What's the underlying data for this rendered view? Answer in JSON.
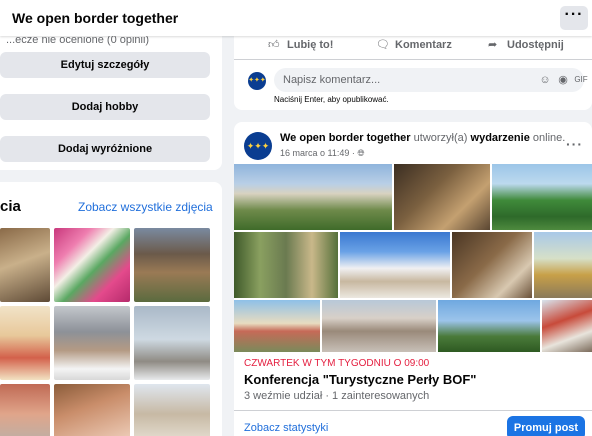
{
  "header": {
    "title": "We open border together",
    "more_label": "···"
  },
  "about": {
    "faded_text": "...ecze nie ocenione (0 opinii)",
    "buttons": [
      "Edytuj szczegóły",
      "Dodaj hobby",
      "Dodaj wyróżnione"
    ]
  },
  "photos": {
    "title": "cia",
    "see_all": "Zobacz wszystkie zdjęcia"
  },
  "post_actions": {
    "like": "Lubię to!",
    "comment": "Komentarz",
    "share": "Udostępnij"
  },
  "comment_box": {
    "placeholder": "Napisz komentarz...",
    "hint": "Naciśnij Enter, aby opublikować."
  },
  "event_post": {
    "page_name": "We open border together",
    "verb": "utworzył(a)",
    "object": "wydarzenie",
    "suffix": "online.",
    "meta": "16 marca o 11:49 · ",
    "globe_icon": "globe-icon",
    "event_date": "CZWARTEK W TYM TYGODNIU O 09:00",
    "event_title": "Konferencja \"Turystyczne Perły BOF\"",
    "event_stats": "3 weźmie udział · 1 zainteresowanych",
    "see_stats": "Zobacz statystyki",
    "promote": "Promuj post"
  },
  "colors": {
    "accent": "#1b74e4",
    "link": "#216fdb",
    "event_date": "#e41e3f",
    "eu_blue": "#0a3d91",
    "eu_star": "#ffd23f"
  }
}
